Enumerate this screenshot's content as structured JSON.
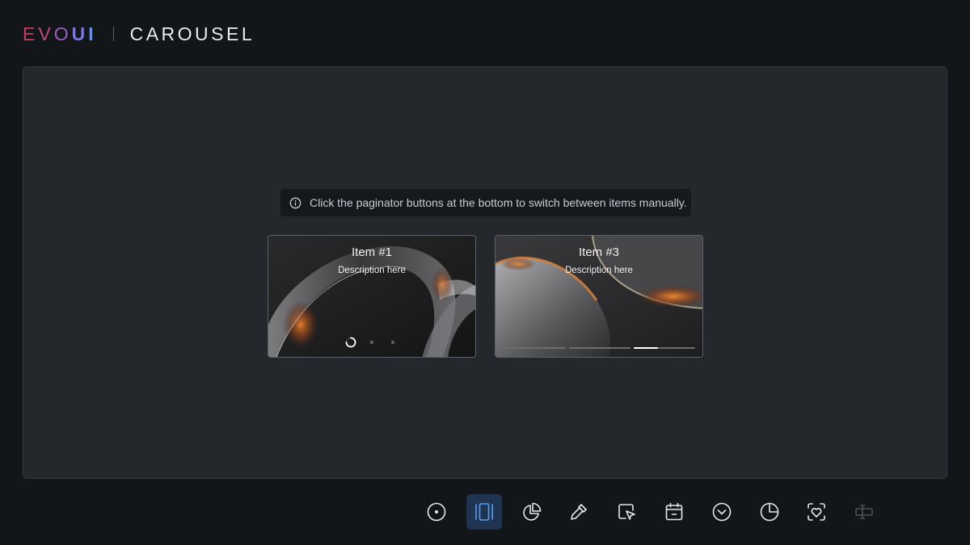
{
  "brand": {
    "letters": [
      "E",
      "V",
      "O",
      "U",
      "I"
    ]
  },
  "header": {
    "title": "CAROUSEL"
  },
  "info": {
    "text": "Click the paginator buttons at the bottom to switch between items manually.",
    "icon": "info-icon"
  },
  "cards": [
    {
      "title": "Item #1",
      "description": "Description here",
      "paginator": "dots",
      "active_index": 0,
      "count": 3
    },
    {
      "title": "Item #3",
      "description": "Description here",
      "paginator": "bars",
      "active_index": 2,
      "count": 3,
      "active_progress": 0.4
    }
  ],
  "toolbar": {
    "items": [
      {
        "icon": "radio-icon",
        "active": false
      },
      {
        "icon": "carousel-icon",
        "active": true
      },
      {
        "icon": "pie-chart-icon",
        "active": false
      },
      {
        "icon": "color-picker-icon",
        "active": false
      },
      {
        "icon": "cursor-select-icon",
        "active": false
      },
      {
        "icon": "calendar-icon",
        "active": false
      },
      {
        "icon": "chevron-down-circle-icon",
        "active": false
      },
      {
        "icon": "half-circle-icon",
        "active": false
      },
      {
        "icon": "heart-scan-icon",
        "active": false
      },
      {
        "icon": "text-input-icon",
        "active": false,
        "disabled": true
      }
    ]
  },
  "colors": {
    "background": "#131619",
    "panel": "#24272c",
    "accent": "#5a9cf0",
    "active_tool_bg": "#1e3450"
  }
}
